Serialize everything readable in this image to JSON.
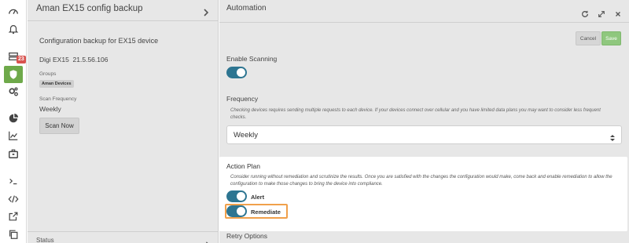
{
  "rail": {
    "badge": "23"
  },
  "device_panel": {
    "title": "Aman EX15 config backup",
    "heading": "Configuration backup for EX15 device",
    "model": "Digi EX15",
    "firmware": "21.5.56.106",
    "groups_label": "Groups",
    "group_tag": "Aman Devices",
    "scan_frequency_label": "Scan Frequency",
    "scan_frequency_value": "Weekly",
    "scan_now_label": "Scan Now",
    "status_label": "Status"
  },
  "automation": {
    "title": "Automation",
    "cancel_label": "Cancel",
    "save_label": "Save",
    "enable_scanning_label": "Enable Scanning",
    "enable_scanning_on": true,
    "frequency_label": "Frequency",
    "frequency_help_1": "Checking devices requires sending multiple requests to each device. If your devices connect over cellular and you have limited data plans you may want to consider less frequent",
    "frequency_help_2": "checks.",
    "frequency_value": "Weekly",
    "action_plan": {
      "title": "Action Plan",
      "help": "Consider running without remediation and scrutinize the results. Once you are satisfied with the changes the configuration would make, come back and enable remediation to allow the configuration to make those changes to bring the device into compliance.",
      "alert_label": "Alert",
      "alert_on": true,
      "remediate_label": "Remediate",
      "remediate_on": true
    },
    "retry_label": "Retry Options"
  },
  "colors": {
    "accent": "#6ea94a",
    "toggle_on": "#2d7591",
    "badge": "#d9534f",
    "highlight": "#f0a04b"
  }
}
